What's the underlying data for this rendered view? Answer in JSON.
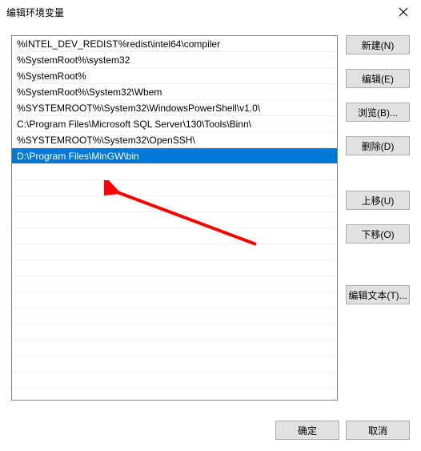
{
  "window": {
    "title": "编辑环境变量"
  },
  "list": {
    "items": [
      "%INTEL_DEV_REDIST%redist\\intel64\\compiler",
      "%SystemRoot%\\system32",
      "%SystemRoot%",
      "%SystemRoot%\\System32\\Wbem",
      "%SYSTEMROOT%\\System32\\WindowsPowerShell\\v1.0\\",
      "C:\\Program Files\\Microsoft SQL Server\\130\\Tools\\Binn\\",
      "%SYSTEMROOT%\\System32\\OpenSSH\\",
      "D:\\Program Files\\MinGW\\bin"
    ],
    "selected_index": 7
  },
  "buttons": {
    "new_": "新建(N)",
    "edit": "编辑(E)",
    "browse": "浏览(B)...",
    "delete_": "删除(D)",
    "move_up": "上移(U)",
    "move_down": "下移(O)",
    "edit_text": "编辑文本(T)..."
  },
  "footer": {
    "ok": "确定",
    "cancel": "取消"
  },
  "colors": {
    "selection": "#0078d7",
    "arrow": "#ff0000"
  }
}
